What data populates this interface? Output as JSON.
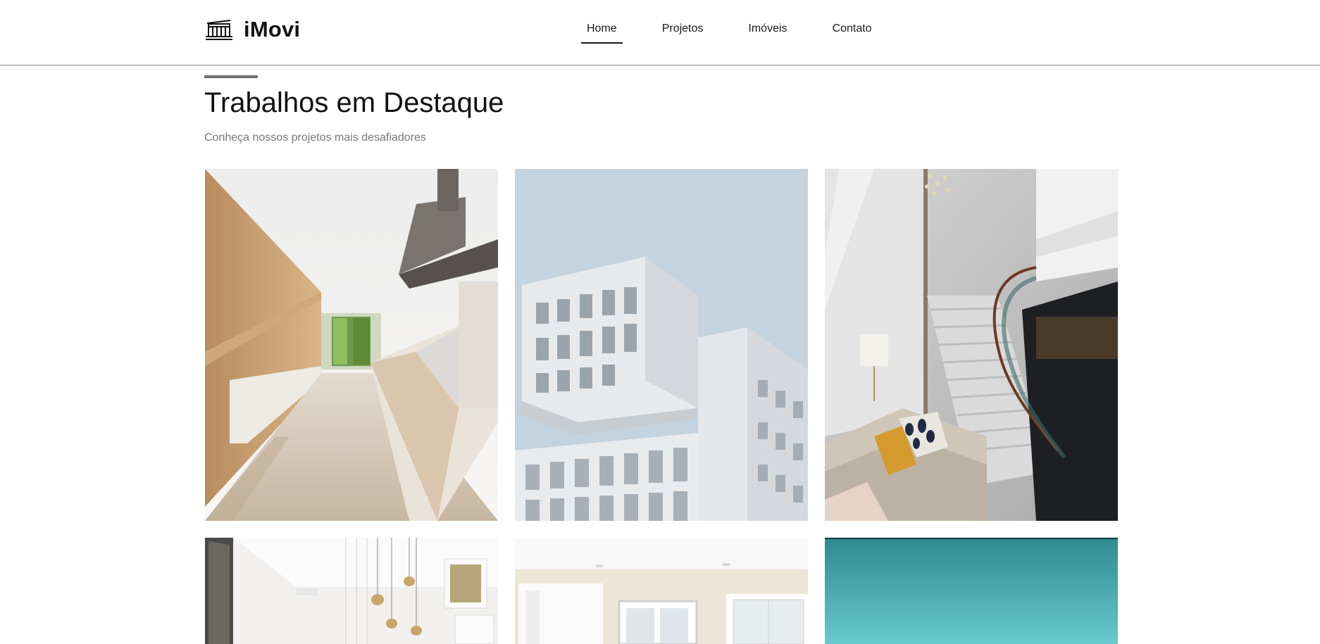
{
  "header": {
    "brand": "iMovi",
    "logo_icon": "building-icon",
    "nav": [
      {
        "label": "Home",
        "active": true
      },
      {
        "label": "Projetos",
        "active": false
      },
      {
        "label": "Imóveis",
        "active": false
      },
      {
        "label": "Contato",
        "active": false
      }
    ]
  },
  "featured": {
    "title": "Trabalhos em Destaque",
    "subtitle": "Conheça nossos projetos mais desafiadores"
  },
  "gallery": {
    "items": [
      {
        "photo": "kitchen-interior"
      },
      {
        "photo": "white-building-facade"
      },
      {
        "photo": "staircase-lobby"
      },
      {
        "photo": "hallway-pendant-lights"
      },
      {
        "photo": "white-room-doors"
      },
      {
        "photo": "teal-sky"
      }
    ]
  },
  "colors": {
    "text": "#111111",
    "subtle": "#777777",
    "divider": "#8a8a8a",
    "accent_bar": "#6f6f6f"
  }
}
